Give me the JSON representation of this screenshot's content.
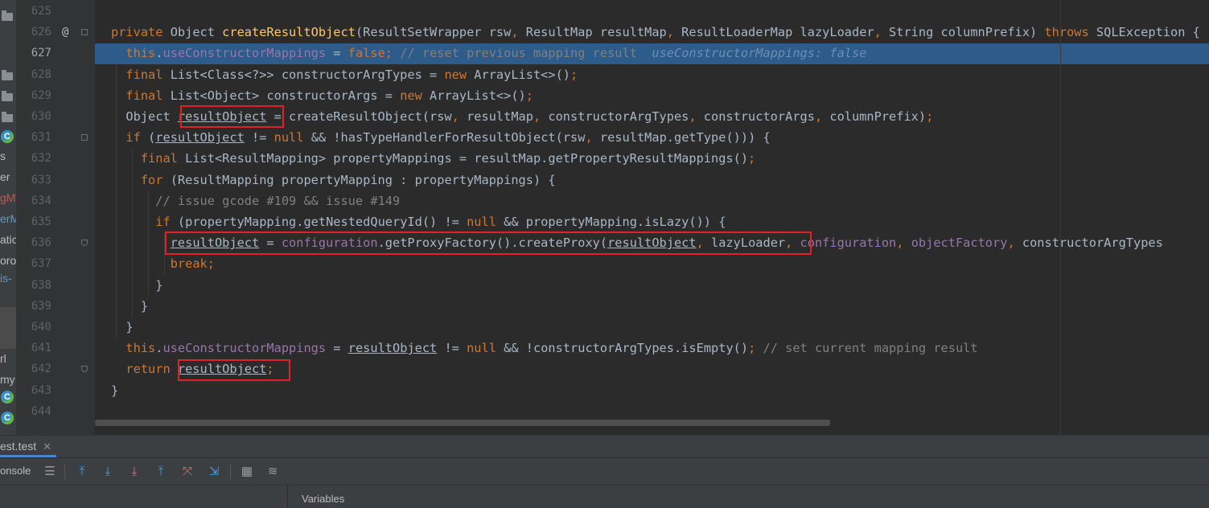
{
  "left_panel": {
    "fragments": [
      {
        "text": "s",
        "style": "normal"
      },
      {
        "text": "er",
        "style": "normal"
      },
      {
        "text": "gM",
        "style": "err"
      },
      {
        "text": "erM",
        "style": "blue"
      },
      {
        "text": "atic",
        "style": "normal"
      },
      {
        "text": "oro",
        "style": "normal"
      },
      {
        "text": "is-",
        "style": "blue"
      },
      {
        "text": "rl",
        "style": "normal"
      },
      {
        "text": "my",
        "style": "normal"
      }
    ]
  },
  "editor": {
    "current_line": "627",
    "breakpoint_marker": "@",
    "line_numbers": [
      "625",
      "626",
      "627",
      "628",
      "629",
      "630",
      "631",
      "632",
      "633",
      "634",
      "635",
      "636",
      "637",
      "638",
      "639",
      "640",
      "641",
      "642",
      "643",
      "644"
    ],
    "lines": [
      [],
      [
        {
          "t": "private ",
          "c": "kw"
        },
        {
          "t": "Object "
        },
        {
          "t": "createResultObject",
          "c": "fn"
        },
        {
          "t": "(ResultSetWrapper rsw"
        },
        {
          "t": ", ",
          "c": "kw"
        },
        {
          "t": "ResultMap resultMap"
        },
        {
          "t": ", ",
          "c": "kw"
        },
        {
          "t": "ResultLoaderMap lazyLoader"
        },
        {
          "t": ", ",
          "c": "kw"
        },
        {
          "t": "String columnPrefix) "
        },
        {
          "t": "throws ",
          "c": "kw"
        },
        {
          "t": "SQLException {"
        }
      ],
      [
        {
          "t": "  "
        },
        {
          "t": "this",
          "c": "kw"
        },
        {
          "t": "."
        },
        {
          "t": "useConstructorMappings",
          "c": "fld"
        },
        {
          "t": " = "
        },
        {
          "t": "false",
          "c": "kw"
        },
        {
          "t": "; ",
          "c": "kw"
        },
        {
          "t": "// reset previous mapping result",
          "c": "cm"
        },
        {
          "t": "  "
        },
        {
          "t": "useConstructorMappings: false",
          "c": "hint"
        }
      ],
      [
        {
          "t": "  "
        },
        {
          "t": "final ",
          "c": "kw"
        },
        {
          "t": "List<Class<?>> constructorArgTypes = "
        },
        {
          "t": "new ",
          "c": "kw"
        },
        {
          "t": "ArrayList<>()"
        },
        {
          "t": ";",
          "c": "kw"
        }
      ],
      [
        {
          "t": "  "
        },
        {
          "t": "final ",
          "c": "kw"
        },
        {
          "t": "List<Object> constructorArgs = "
        },
        {
          "t": "new ",
          "c": "kw"
        },
        {
          "t": "ArrayList<>()"
        },
        {
          "t": ";",
          "c": "kw"
        }
      ],
      [
        {
          "t": "  Object "
        },
        {
          "t": "resultObject",
          "c": "u"
        },
        {
          "t": " = createResultObject(rsw"
        },
        {
          "t": ", ",
          "c": "kw"
        },
        {
          "t": "resultMap"
        },
        {
          "t": ", ",
          "c": "kw"
        },
        {
          "t": "constructorArgTypes"
        },
        {
          "t": ", ",
          "c": "kw"
        },
        {
          "t": "constructorArgs"
        },
        {
          "t": ", ",
          "c": "kw"
        },
        {
          "t": "columnPrefix)"
        },
        {
          "t": ";",
          "c": "kw"
        }
      ],
      [
        {
          "t": "  "
        },
        {
          "t": "if ",
          "c": "kw"
        },
        {
          "t": "("
        },
        {
          "t": "resultObject",
          "c": "u"
        },
        {
          "t": " != "
        },
        {
          "t": "null ",
          "c": "kw"
        },
        {
          "t": "&& !hasTypeHandlerForResultObject(rsw"
        },
        {
          "t": ", ",
          "c": "kw"
        },
        {
          "t": "resultMap.getType())) {"
        }
      ],
      [
        {
          "t": "    "
        },
        {
          "t": "final ",
          "c": "kw"
        },
        {
          "t": "List<ResultMapping> propertyMappings = resultMap.getPropertyResultMappings()"
        },
        {
          "t": ";",
          "c": "kw"
        }
      ],
      [
        {
          "t": "    "
        },
        {
          "t": "for ",
          "c": "kw"
        },
        {
          "t": "(ResultMapping propertyMapping : propertyMappings) {"
        }
      ],
      [
        {
          "t": "      "
        },
        {
          "t": "// issue gcode #109 && issue #149",
          "c": "cm"
        }
      ],
      [
        {
          "t": "      "
        },
        {
          "t": "if ",
          "c": "kw"
        },
        {
          "t": "(propertyMapping.getNestedQueryId() != "
        },
        {
          "t": "null ",
          "c": "kw"
        },
        {
          "t": "&& propertyMapping.isLazy()) {"
        }
      ],
      [
        {
          "t": "        "
        },
        {
          "t": "resultObject",
          "c": "u"
        },
        {
          "t": " = "
        },
        {
          "t": "configuration",
          "c": "fld"
        },
        {
          "t": ".getProxyFactory().createProxy("
        },
        {
          "t": "resultObject",
          "c": "u"
        },
        {
          "t": ", ",
          "c": "kw"
        },
        {
          "t": "lazyLoader"
        },
        {
          "t": ", ",
          "c": "kw"
        },
        {
          "t": "configuration",
          "c": "fld"
        },
        {
          "t": ", ",
          "c": "kw"
        },
        {
          "t": "objectFactory",
          "c": "fld"
        },
        {
          "t": ", ",
          "c": "kw"
        },
        {
          "t": "constructorArgTypes"
        }
      ],
      [
        {
          "t": "        "
        },
        {
          "t": "break",
          "c": "kw"
        },
        {
          "t": ";",
          "c": "kw"
        }
      ],
      [
        {
          "t": "      }"
        }
      ],
      [
        {
          "t": "    }"
        }
      ],
      [
        {
          "t": "  }"
        }
      ],
      [
        {
          "t": "  "
        },
        {
          "t": "this",
          "c": "kw"
        },
        {
          "t": "."
        },
        {
          "t": "useConstructorMappings",
          "c": "fld"
        },
        {
          "t": " = "
        },
        {
          "t": "resultObject",
          "c": "u"
        },
        {
          "t": " != "
        },
        {
          "t": "null ",
          "c": "kw"
        },
        {
          "t": "&& !constructorArgTypes.isEmpty()"
        },
        {
          "t": "; ",
          "c": "kw"
        },
        {
          "t": "// set current mapping result",
          "c": "cm"
        }
      ],
      [
        {
          "t": "  "
        },
        {
          "t": "return ",
          "c": "kw"
        },
        {
          "t": "resultObject",
          "c": "u"
        },
        {
          "t": ";",
          "c": "kw"
        }
      ],
      [
        {
          "t": "}"
        }
      ],
      []
    ]
  },
  "debug": {
    "tab_label": "est.test",
    "tab_close": "✕",
    "console_label": "onsole",
    "variables_label": "Variables"
  },
  "colors": {
    "editor_bg": "#2b2b2b",
    "keyword": "#cc7832",
    "method": "#ffc66d",
    "field": "#9876aa",
    "comment": "#808080",
    "execution_line": "#2d5b8a",
    "annotation_box": "#e0202a"
  }
}
